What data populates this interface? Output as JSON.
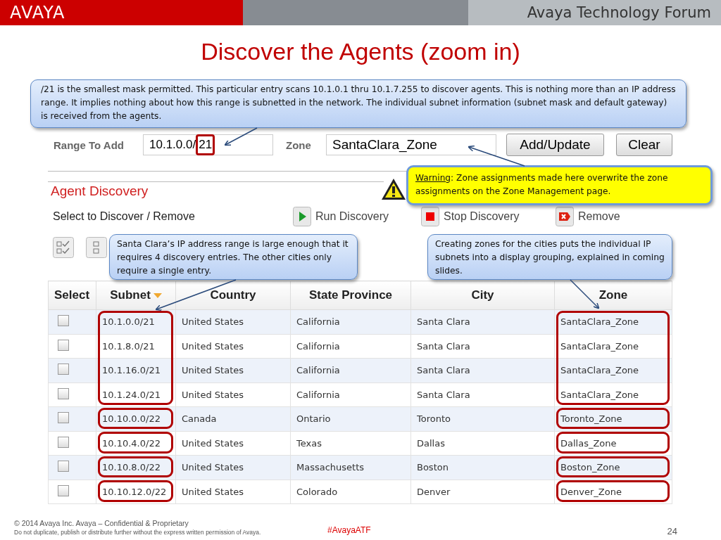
{
  "header": {
    "logo": "AVAYA",
    "forum": "Avaya Technology Forum"
  },
  "title": "Discover the Agents (zoom in)",
  "callouts": [
    {
      "kind": "info",
      "text": "/21 is the smallest mask permitted. This particular entry scans 10.1.0.1 thru 10.1.7.255 to discover agents. This is nothing more than an IP address range. It implies nothing about how this range is subnetted in the network. The individual subnet information (subnet mask and default gateway) is received from the agents."
    },
    {
      "kind": "warning",
      "lead": "Warning",
      "rest": ": Zone assignments made here overwrite the zone assignments on the Zone Management page."
    },
    {
      "kind": "info",
      "text": "Santa Clara’s IP address range is large enough that it requires 4 discovery entries. The other cities only require a single entry."
    },
    {
      "kind": "info",
      "text": "Creating zones for the cities puts the individual IP subnets into a display grouping, explained in coming slides."
    }
  ],
  "form": {
    "range_label": "Range To Add",
    "range_base": "10.1.0.0/",
    "range_mask": "21",
    "mask_highlighted": true,
    "zone_label": "Zone",
    "zone_value": "SantaClara_Zone",
    "buttons": [
      "Add/Update",
      "Clear"
    ]
  },
  "discovery": {
    "title": "Agent Discovery",
    "select_label": "Select to Discover / Remove",
    "actions": [
      {
        "kind": "run",
        "label": "Run Discovery"
      },
      {
        "kind": "stop",
        "label": "Stop Discovery"
      },
      {
        "kind": "remove",
        "label": "Remove"
      }
    ]
  },
  "table": {
    "columns": [
      {
        "label": "Select",
        "sorted": false,
        "highlighted": false
      },
      {
        "label": "Subnet",
        "sorted": true,
        "highlighted": true
      },
      {
        "label": "Country",
        "sorted": false,
        "highlighted": false
      },
      {
        "label": "State Province",
        "sorted": false,
        "highlighted": false
      },
      {
        "label": "City",
        "sorted": false,
        "highlighted": false
      },
      {
        "label": "Zone",
        "sorted": false,
        "highlighted": true
      }
    ],
    "row_groups": [
      {
        "highlighted": true,
        "rows": [
          {
            "checked": false,
            "cells": [
              "10.1.0.0/21",
              "United States",
              "California",
              "Santa Clara",
              "SantaClara_Zone"
            ]
          },
          {
            "checked": false,
            "cells": [
              "10.1.8.0/21",
              "United States",
              "California",
              "Santa Clara",
              "SantaClara_Zone"
            ]
          },
          {
            "checked": false,
            "cells": [
              "10.1.16.0/21",
              "United States",
              "California",
              "Santa Clara",
              "SantaClara_Zone"
            ]
          },
          {
            "checked": false,
            "cells": [
              "10.1.24.0/21",
              "United States",
              "California",
              "Santa Clara",
              "SantaClara_Zone"
            ]
          }
        ]
      },
      {
        "highlighted": true,
        "rows": [
          {
            "checked": false,
            "cells": [
              "10.10.0.0/22",
              "Canada",
              "Ontario",
              "Toronto",
              "Toronto_Zone"
            ]
          }
        ]
      },
      {
        "highlighted": true,
        "rows": [
          {
            "checked": false,
            "cells": [
              "10.10.4.0/22",
              "United States",
              "Texas",
              "Dallas",
              "Dallas_Zone"
            ]
          }
        ]
      },
      {
        "highlighted": true,
        "rows": [
          {
            "checked": false,
            "cells": [
              "10.10.8.0/22",
              "United States",
              "Massachusetts",
              "Boston",
              "Boston_Zone"
            ]
          }
        ]
      },
      {
        "highlighted": true,
        "rows": [
          {
            "checked": false,
            "cells": [
              "10.10.12.0/22",
              "United States",
              "Colorado",
              "Denver",
              "Denver_Zone"
            ]
          }
        ]
      }
    ]
  },
  "footer": {
    "copyright": "© 2014 Avaya Inc. Avaya – Confidential & Proprietary",
    "notice": "Do not duplicate, publish or distribute further without the express written permission of Avaya.",
    "hashtag": "#AvayaATF",
    "page": "24"
  }
}
